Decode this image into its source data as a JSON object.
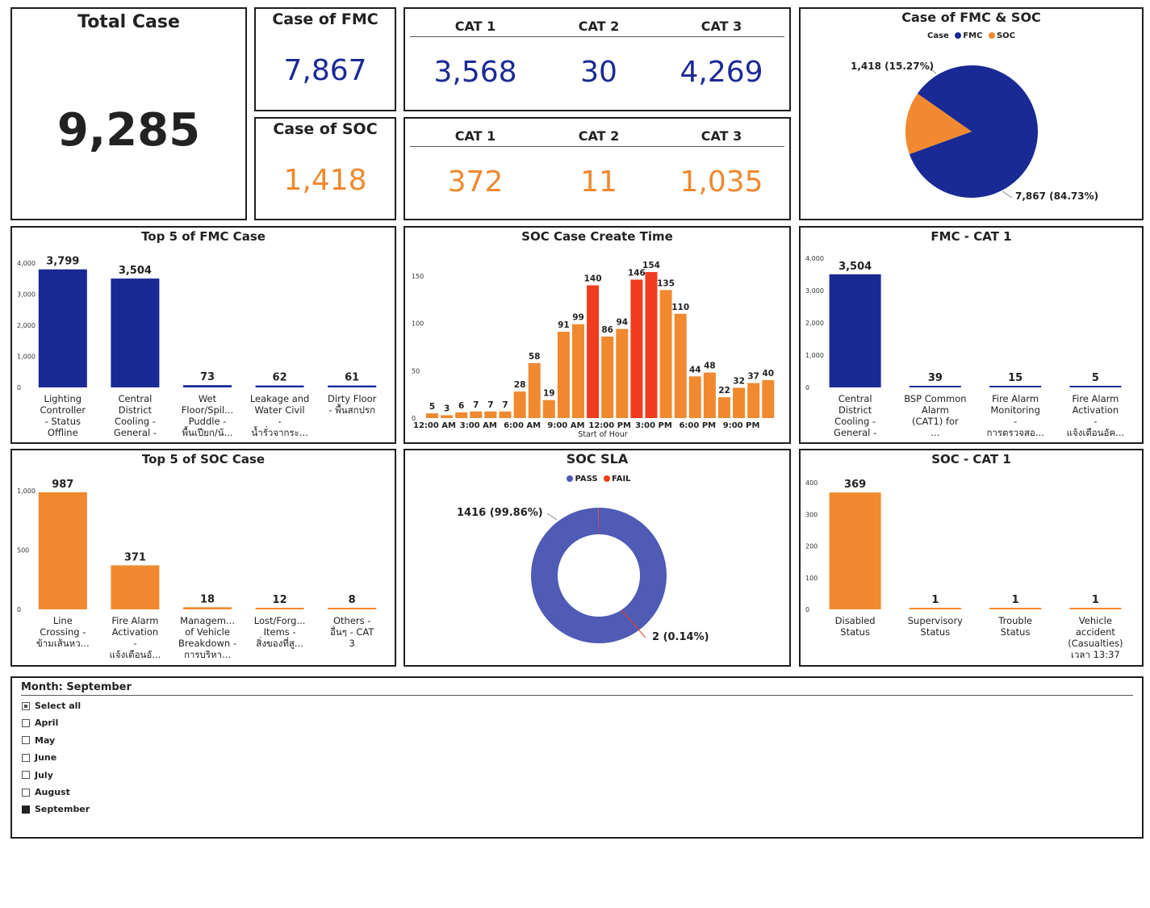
{
  "total": {
    "title": "Total Case",
    "value": "9,285"
  },
  "fmc": {
    "title": "Case of FMC",
    "value": "7,867"
  },
  "soc": {
    "title": "Case of SOC",
    "value": "1,418"
  },
  "fmc_cats": [
    {
      "label": "CAT 1",
      "value": "3,568"
    },
    {
      "label": "CAT 2",
      "value": "30"
    },
    {
      "label": "CAT 3",
      "value": "4,269"
    }
  ],
  "soc_cats": [
    {
      "label": "CAT 1",
      "value": "372"
    },
    {
      "label": "CAT 2",
      "value": "11"
    },
    {
      "label": "CAT 3",
      "value": "1,035"
    }
  ],
  "pie": {
    "title": "Case of FMC & SOC",
    "legend_title": "Case",
    "legend": [
      "FMC",
      "SOC"
    ],
    "soc_label": "1,418 (15.27%)",
    "fmc_label": "7,867 (84.73%)"
  },
  "donut": {
    "title": "SOC SLA",
    "legend": [
      "PASS",
      "FAIL"
    ],
    "pass_label": "1416 (99.86%)",
    "fail_label": "2 (0.14%)"
  },
  "slicer": {
    "title": "Month: September",
    "items": [
      {
        "label": "Select all",
        "state": "partial"
      },
      {
        "label": "April",
        "state": "off"
      },
      {
        "label": "May",
        "state": "off"
      },
      {
        "label": "June",
        "state": "off"
      },
      {
        "label": "July",
        "state": "off"
      },
      {
        "label": "August",
        "state": "off"
      },
      {
        "label": "September",
        "state": "checked"
      }
    ]
  },
  "colors": {
    "navy": "#1a2a94",
    "orange": "#f0892f",
    "red": "#f03c1e",
    "donut_blue": "#4f5bb5"
  },
  "chart_data": [
    {
      "id": "pie-fmc-soc",
      "type": "pie",
      "title": "Case of FMC & SOC",
      "categories": [
        "FMC",
        "SOC"
      ],
      "values": [
        7867,
        1418
      ]
    },
    {
      "id": "top5-fmc",
      "type": "bar",
      "title": "Top 5 of FMC Case",
      "categories": [
        "Lighting Controller - Status Offline ชุด...",
        "Central District Cooling - General - ...",
        "Wet Floor/Spil... Puddle - พื้นเปียก/น้...",
        "Leakage and Water Civil - น้ำรั่วจากระ...",
        "Dirty Floor - พื้นสกปรก"
      ],
      "values": [
        3799,
        3504,
        73,
        62,
        61
      ],
      "value_labels": [
        "3,799",
        "3,504",
        "73",
        "62",
        "61"
      ],
      "yticks": [
        "0",
        "1,000",
        "2,000",
        "3,000",
        "4,000"
      ],
      "ylim": [
        0,
        4000
      ]
    },
    {
      "id": "soc-create-time",
      "type": "bar",
      "title": "SOC Case Create Time",
      "xlabel": "Start of Hour",
      "x_tick_labels": [
        "12:00 AM",
        "3:00 AM",
        "6:00 AM",
        "9:00 AM",
        "12:00 PM",
        "3:00 PM",
        "6:00 PM",
        "9:00 PM"
      ],
      "values": [
        5,
        3,
        6,
        7,
        7,
        7,
        28,
        58,
        19,
        91,
        99,
        140,
        86,
        94,
        146,
        154,
        135,
        110,
        44,
        48,
        22,
        32,
        37,
        40
      ],
      "highlight": [
        false,
        false,
        false,
        false,
        false,
        false,
        false,
        false,
        false,
        false,
        false,
        true,
        false,
        false,
        true,
        true,
        false,
        false,
        false,
        false,
        false,
        false,
        false,
        false
      ],
      "yticks": [
        "0",
        "50",
        "100",
        "150"
      ],
      "ylim": [
        0,
        160
      ]
    },
    {
      "id": "fmc-cat1",
      "type": "bar",
      "title": "FMC - CAT 1",
      "categories": [
        "Central District Cooling - General - ร...",
        "BSP Common Alarm (CAT1) for ...",
        "Fire Alarm Monitoring - การตรวจสอ...",
        "Fire Alarm Activation - แจ้งเตือนอัค..."
      ],
      "values": [
        3504,
        39,
        15,
        5
      ],
      "value_labels": [
        "3,504",
        "39",
        "15",
        "5"
      ],
      "yticks": [
        "0",
        "1,000",
        "2,000",
        "3,000",
        "4,000"
      ],
      "ylim": [
        0,
        4000
      ]
    },
    {
      "id": "top5-soc",
      "type": "bar",
      "title": "Top 5 of SOC Case",
      "categories": [
        "Line Crossing - ข้ามเส้นหว...",
        "Fire Alarm Activation - แจ้งเตือนอั...",
        "Managem... of Vehicle Breakdown - การบริหา...",
        "Lost/Forg... Items - สิ่งของที่สู...",
        "Others - อื่นๆ - CAT 3"
      ],
      "values": [
        987,
        371,
        18,
        12,
        8
      ],
      "value_labels": [
        "987",
        "371",
        "18",
        "12",
        "8"
      ],
      "yticks": [
        "0",
        "500",
        "1,000"
      ],
      "ylim": [
        0,
        1000
      ]
    },
    {
      "id": "soc-sla",
      "type": "pie",
      "title": "SOC SLA",
      "categories": [
        "PASS",
        "FAIL"
      ],
      "values": [
        1416,
        2
      ]
    },
    {
      "id": "soc-cat1",
      "type": "bar",
      "title": "SOC - CAT 1",
      "categories": [
        "Disabled Status",
        "Supervisory Status",
        "Trouble Status",
        "Vehicle accident (Casualties) เวลา 13:37 ..."
      ],
      "values": [
        369,
        1,
        1,
        1
      ],
      "value_labels": [
        "369",
        "1",
        "1",
        "1"
      ],
      "yticks": [
        "0",
        "100",
        "200",
        "300",
        "400"
      ],
      "ylim": [
        0,
        400
      ]
    }
  ]
}
